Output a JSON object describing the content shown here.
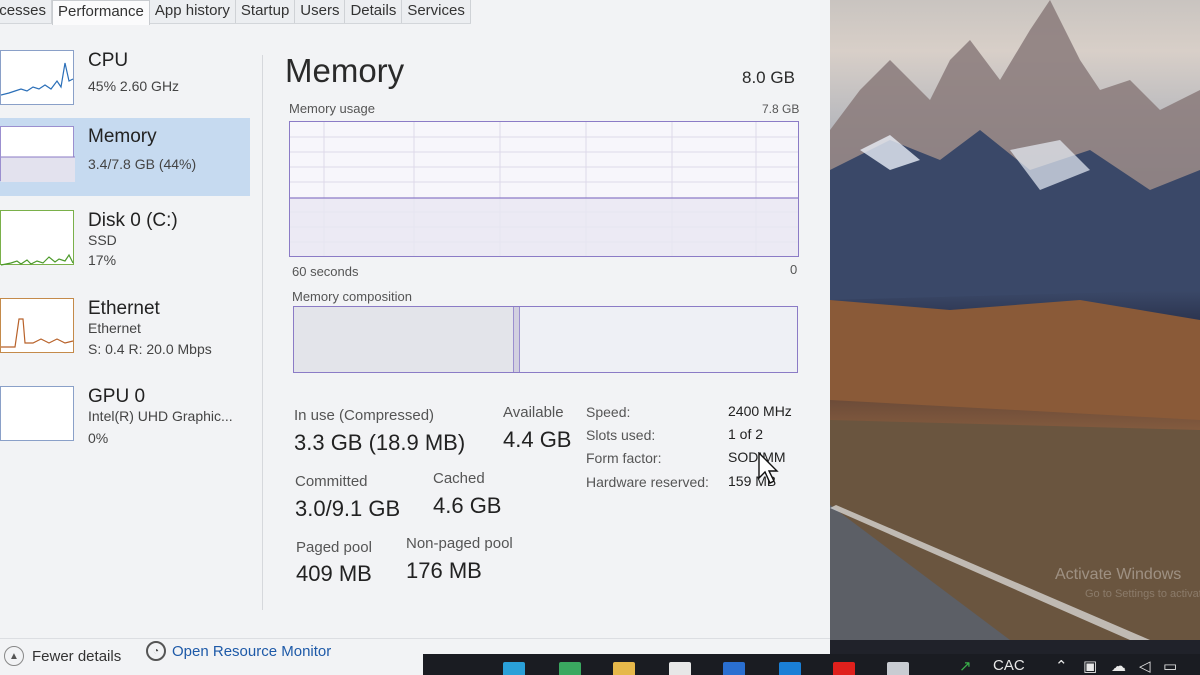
{
  "tabs": [
    "Processes",
    "Performance",
    "App history",
    "Startup",
    "Users",
    "Details",
    "Services"
  ],
  "sidebar": {
    "items": [
      {
        "title": "CPU",
        "lines": [
          "45% 2.60 GHz"
        ]
      },
      {
        "title": "Memory",
        "lines": [
          "3.4/7.8 GB (44%)"
        ]
      },
      {
        "title": "Disk 0 (C:)",
        "lines": [
          "SSD",
          "17%"
        ]
      },
      {
        "title": "Ethernet",
        "lines": [
          "Ethernet",
          "S: 0.4 R: 20.0 Mbps"
        ]
      },
      {
        "title": "GPU 0",
        "lines": [
          "Intel(R) UHD Graphic...",
          "0%"
        ]
      }
    ]
  },
  "main": {
    "title": "Memory",
    "total": "8.0 GB",
    "usage_label": "Memory usage",
    "usage_max": "7.8 GB",
    "time_label": "60 seconds",
    "time_end": "0",
    "composition_label": "Memory composition",
    "stats": {
      "in_use_label": "In use (Compressed)",
      "in_use_value": "3.3 GB (18.9 MB)",
      "available_label": "Available",
      "available_value": "4.4 GB",
      "committed_label": "Committed",
      "committed_value": "3.0/9.1 GB",
      "cached_label": "Cached",
      "cached_value": "4.6 GB",
      "paged_label": "Paged pool",
      "paged_value": "409 MB",
      "nonpaged_label": "Non-paged pool",
      "nonpaged_value": "176 MB"
    },
    "specs": [
      {
        "label": "Speed:",
        "value": "2400 MHz"
      },
      {
        "label": "Slots used:",
        "value": "1 of 2"
      },
      {
        "label": "Form factor:",
        "value": "SODIMM"
      },
      {
        "label": "Hardware reserved:",
        "value": "159 MB"
      }
    ]
  },
  "footer": {
    "fewer_details": "Fewer details",
    "open_resource_monitor": "Open Resource Monitor"
  },
  "watermark": {
    "line1": "Activate Windows",
    "line2": "Go to Settings to activate"
  },
  "taskbar": {
    "tray_text": "CAC",
    "icons": [
      {
        "name": "edge-icon",
        "color": "#2aa0d8"
      },
      {
        "name": "chrome-icon",
        "color": "#3aa860"
      },
      {
        "name": "file-explorer-icon",
        "color": "#e6b84a"
      },
      {
        "name": "store-icon",
        "color": "#e7e7e7"
      },
      {
        "name": "mail-icon",
        "color": "#2a6fd0"
      },
      {
        "name": "edge-dev-icon",
        "color": "#1a7fd6"
      },
      {
        "name": "youtube-icon",
        "color": "#e0201c"
      },
      {
        "name": "task-manager-icon",
        "color": "#c8ccd2"
      }
    ]
  }
}
